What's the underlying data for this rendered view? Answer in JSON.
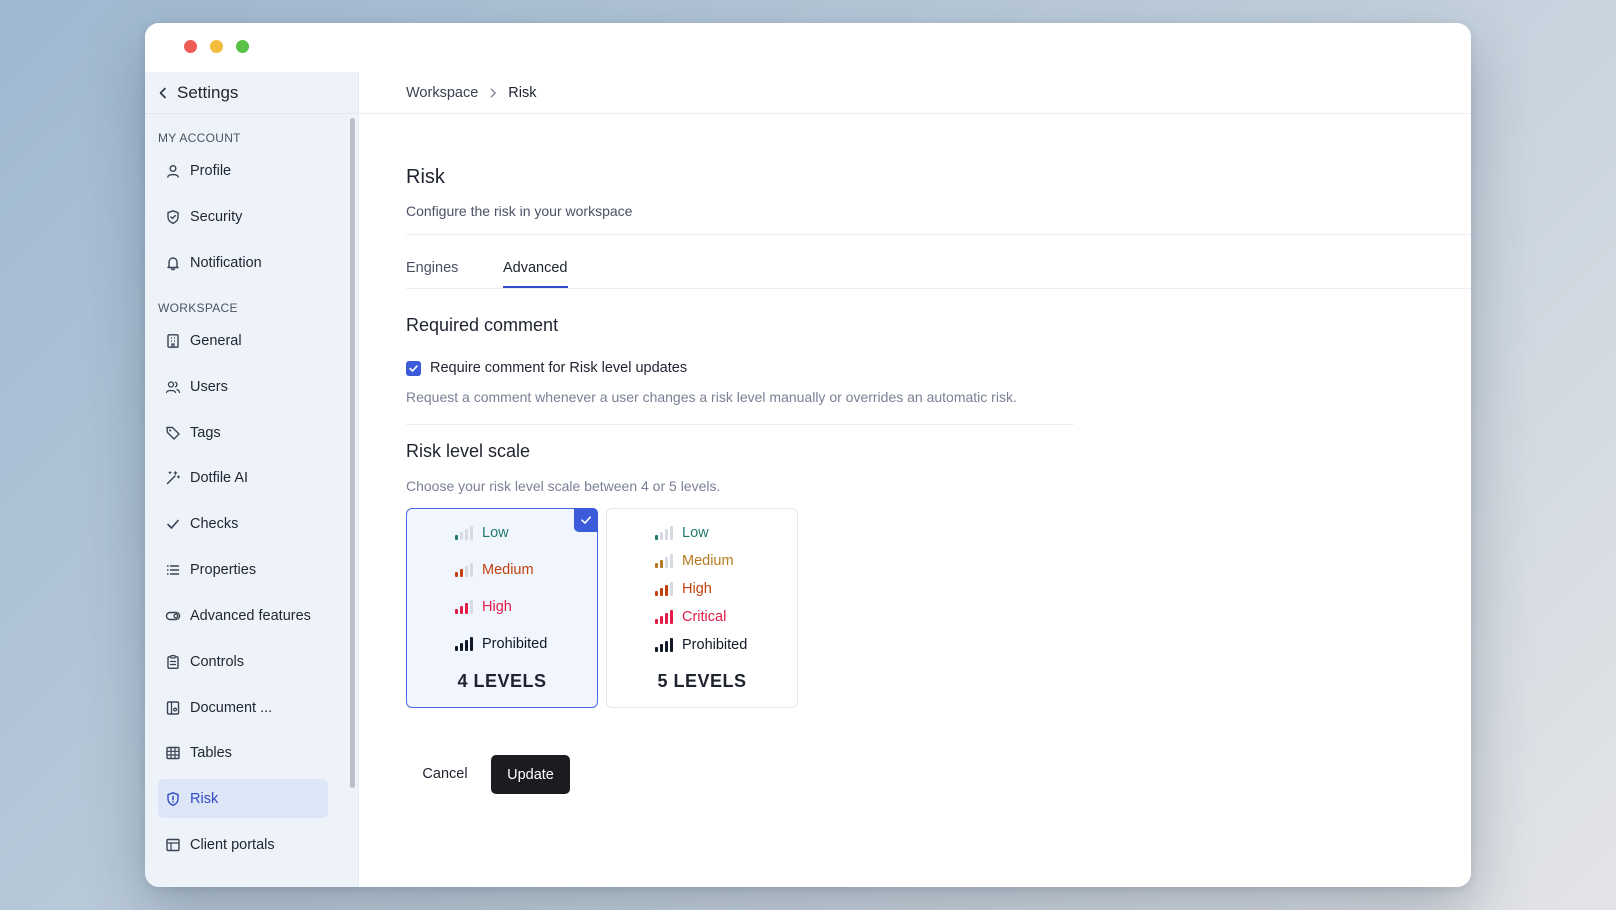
{
  "window": {
    "title_bar_buttons": [
      "close",
      "minimize",
      "maximize"
    ]
  },
  "sidebar": {
    "back_label": "Settings",
    "sections": [
      {
        "label": "MY ACCOUNT",
        "items": [
          {
            "label": "Profile",
            "icon": "user-icon"
          },
          {
            "label": "Security",
            "icon": "shield-icon"
          },
          {
            "label": "Notification",
            "icon": "bell-icon"
          }
        ]
      },
      {
        "label": "WORKSPACE",
        "items": [
          {
            "label": "General",
            "icon": "building-icon"
          },
          {
            "label": "Users",
            "icon": "users-icon"
          },
          {
            "label": "Tags",
            "icon": "tag-icon"
          },
          {
            "label": "Dotfile AI",
            "icon": "magic-wand-icon"
          },
          {
            "label": "Checks",
            "icon": "check-icon"
          },
          {
            "label": "Properties",
            "icon": "list-icon"
          },
          {
            "label": "Advanced features",
            "icon": "toggle-icon"
          },
          {
            "label": "Controls",
            "icon": "clipboard-icon"
          },
          {
            "label": "Document ...",
            "icon": "document-icon"
          },
          {
            "label": "Tables",
            "icon": "table-icon"
          },
          {
            "label": "Risk",
            "icon": "shield-alert-icon",
            "active": true
          },
          {
            "label": "Client portals",
            "icon": "layout-icon"
          }
        ]
      }
    ]
  },
  "breadcrumb": {
    "parent": "Workspace",
    "current": "Risk"
  },
  "page": {
    "title": "Risk",
    "subtitle": "Configure the risk in your workspace"
  },
  "tabs": [
    {
      "label": "Engines"
    },
    {
      "label": "Advanced",
      "active": true
    }
  ],
  "required_comment": {
    "heading": "Required comment",
    "checkbox_label": "Require comment for Risk level updates",
    "checked": true,
    "help": "Request a comment whenever a user changes a risk level manually or overrides an automatic risk."
  },
  "risk_scale": {
    "heading": "Risk level scale",
    "help": "Choose your risk level scale between 4 or 5 levels.",
    "options": [
      {
        "count_label": "4 LEVELS",
        "selected": true,
        "levels": [
          {
            "label": "Low",
            "color": "#1f7a6b",
            "bars": 1
          },
          {
            "label": "Medium",
            "color": "#c2410c",
            "bars": 2
          },
          {
            "label": "High",
            "color": "#e11d48",
            "bars": 3
          },
          {
            "label": "Prohibited",
            "color": "#111827",
            "bars": 4
          }
        ]
      },
      {
        "count_label": "5 LEVELS",
        "selected": false,
        "levels": [
          {
            "label": "Low",
            "color": "#1f7a6b",
            "bars": 1
          },
          {
            "label": "Medium",
            "color": "#b7791f",
            "bars": 2
          },
          {
            "label": "High",
            "color": "#c2410c",
            "bars": 3
          },
          {
            "label": "Critical",
            "color": "#e11d48",
            "bars": 4
          },
          {
            "label": "Prohibited",
            "color": "#111827",
            "bars": 4
          }
        ]
      }
    ]
  },
  "actions": {
    "cancel": "Cancel",
    "update": "Update"
  }
}
